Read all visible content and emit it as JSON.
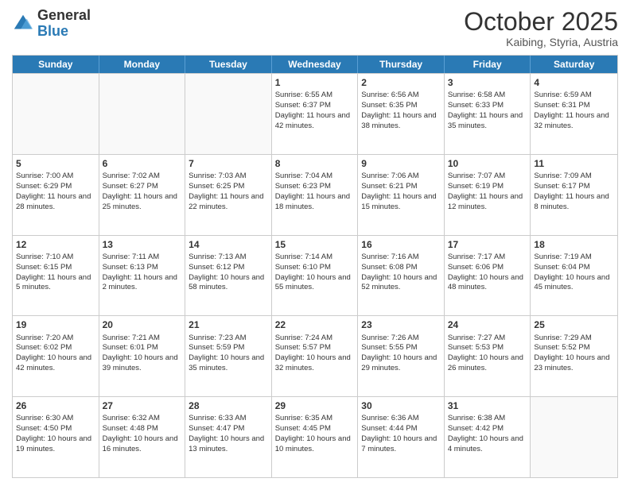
{
  "header": {
    "logo_general": "General",
    "logo_blue": "Blue",
    "month": "October 2025",
    "location": "Kaibing, Styria, Austria"
  },
  "days_of_week": [
    "Sunday",
    "Monday",
    "Tuesday",
    "Wednesday",
    "Thursday",
    "Friday",
    "Saturday"
  ],
  "weeks": [
    [
      {
        "day": "",
        "empty": true
      },
      {
        "day": "",
        "empty": true
      },
      {
        "day": "",
        "empty": true
      },
      {
        "day": "1",
        "sunrise": "Sunrise: 6:55 AM",
        "sunset": "Sunset: 6:37 PM",
        "daylight": "Daylight: 11 hours and 42 minutes."
      },
      {
        "day": "2",
        "sunrise": "Sunrise: 6:56 AM",
        "sunset": "Sunset: 6:35 PM",
        "daylight": "Daylight: 11 hours and 38 minutes."
      },
      {
        "day": "3",
        "sunrise": "Sunrise: 6:58 AM",
        "sunset": "Sunset: 6:33 PM",
        "daylight": "Daylight: 11 hours and 35 minutes."
      },
      {
        "day": "4",
        "sunrise": "Sunrise: 6:59 AM",
        "sunset": "Sunset: 6:31 PM",
        "daylight": "Daylight: 11 hours and 32 minutes."
      }
    ],
    [
      {
        "day": "5",
        "sunrise": "Sunrise: 7:00 AM",
        "sunset": "Sunset: 6:29 PM",
        "daylight": "Daylight: 11 hours and 28 minutes."
      },
      {
        "day": "6",
        "sunrise": "Sunrise: 7:02 AM",
        "sunset": "Sunset: 6:27 PM",
        "daylight": "Daylight: 11 hours and 25 minutes."
      },
      {
        "day": "7",
        "sunrise": "Sunrise: 7:03 AM",
        "sunset": "Sunset: 6:25 PM",
        "daylight": "Daylight: 11 hours and 22 minutes."
      },
      {
        "day": "8",
        "sunrise": "Sunrise: 7:04 AM",
        "sunset": "Sunset: 6:23 PM",
        "daylight": "Daylight: 11 hours and 18 minutes."
      },
      {
        "day": "9",
        "sunrise": "Sunrise: 7:06 AM",
        "sunset": "Sunset: 6:21 PM",
        "daylight": "Daylight: 11 hours and 15 minutes."
      },
      {
        "day": "10",
        "sunrise": "Sunrise: 7:07 AM",
        "sunset": "Sunset: 6:19 PM",
        "daylight": "Daylight: 11 hours and 12 minutes."
      },
      {
        "day": "11",
        "sunrise": "Sunrise: 7:09 AM",
        "sunset": "Sunset: 6:17 PM",
        "daylight": "Daylight: 11 hours and 8 minutes."
      }
    ],
    [
      {
        "day": "12",
        "sunrise": "Sunrise: 7:10 AM",
        "sunset": "Sunset: 6:15 PM",
        "daylight": "Daylight: 11 hours and 5 minutes."
      },
      {
        "day": "13",
        "sunrise": "Sunrise: 7:11 AM",
        "sunset": "Sunset: 6:13 PM",
        "daylight": "Daylight: 11 hours and 2 minutes."
      },
      {
        "day": "14",
        "sunrise": "Sunrise: 7:13 AM",
        "sunset": "Sunset: 6:12 PM",
        "daylight": "Daylight: 10 hours and 58 minutes."
      },
      {
        "day": "15",
        "sunrise": "Sunrise: 7:14 AM",
        "sunset": "Sunset: 6:10 PM",
        "daylight": "Daylight: 10 hours and 55 minutes."
      },
      {
        "day": "16",
        "sunrise": "Sunrise: 7:16 AM",
        "sunset": "Sunset: 6:08 PM",
        "daylight": "Daylight: 10 hours and 52 minutes."
      },
      {
        "day": "17",
        "sunrise": "Sunrise: 7:17 AM",
        "sunset": "Sunset: 6:06 PM",
        "daylight": "Daylight: 10 hours and 48 minutes."
      },
      {
        "day": "18",
        "sunrise": "Sunrise: 7:19 AM",
        "sunset": "Sunset: 6:04 PM",
        "daylight": "Daylight: 10 hours and 45 minutes."
      }
    ],
    [
      {
        "day": "19",
        "sunrise": "Sunrise: 7:20 AM",
        "sunset": "Sunset: 6:02 PM",
        "daylight": "Daylight: 10 hours and 42 minutes."
      },
      {
        "day": "20",
        "sunrise": "Sunrise: 7:21 AM",
        "sunset": "Sunset: 6:01 PM",
        "daylight": "Daylight: 10 hours and 39 minutes."
      },
      {
        "day": "21",
        "sunrise": "Sunrise: 7:23 AM",
        "sunset": "Sunset: 5:59 PM",
        "daylight": "Daylight: 10 hours and 35 minutes."
      },
      {
        "day": "22",
        "sunrise": "Sunrise: 7:24 AM",
        "sunset": "Sunset: 5:57 PM",
        "daylight": "Daylight: 10 hours and 32 minutes."
      },
      {
        "day": "23",
        "sunrise": "Sunrise: 7:26 AM",
        "sunset": "Sunset: 5:55 PM",
        "daylight": "Daylight: 10 hours and 29 minutes."
      },
      {
        "day": "24",
        "sunrise": "Sunrise: 7:27 AM",
        "sunset": "Sunset: 5:53 PM",
        "daylight": "Daylight: 10 hours and 26 minutes."
      },
      {
        "day": "25",
        "sunrise": "Sunrise: 7:29 AM",
        "sunset": "Sunset: 5:52 PM",
        "daylight": "Daylight: 10 hours and 23 minutes."
      }
    ],
    [
      {
        "day": "26",
        "sunrise": "Sunrise: 6:30 AM",
        "sunset": "Sunset: 4:50 PM",
        "daylight": "Daylight: 10 hours and 19 minutes."
      },
      {
        "day": "27",
        "sunrise": "Sunrise: 6:32 AM",
        "sunset": "Sunset: 4:48 PM",
        "daylight": "Daylight: 10 hours and 16 minutes."
      },
      {
        "day": "28",
        "sunrise": "Sunrise: 6:33 AM",
        "sunset": "Sunset: 4:47 PM",
        "daylight": "Daylight: 10 hours and 13 minutes."
      },
      {
        "day": "29",
        "sunrise": "Sunrise: 6:35 AM",
        "sunset": "Sunset: 4:45 PM",
        "daylight": "Daylight: 10 hours and 10 minutes."
      },
      {
        "day": "30",
        "sunrise": "Sunrise: 6:36 AM",
        "sunset": "Sunset: 4:44 PM",
        "daylight": "Daylight: 10 hours and 7 minutes."
      },
      {
        "day": "31",
        "sunrise": "Sunrise: 6:38 AM",
        "sunset": "Sunset: 4:42 PM",
        "daylight": "Daylight: 10 hours and 4 minutes."
      },
      {
        "day": "",
        "empty": true
      }
    ]
  ]
}
